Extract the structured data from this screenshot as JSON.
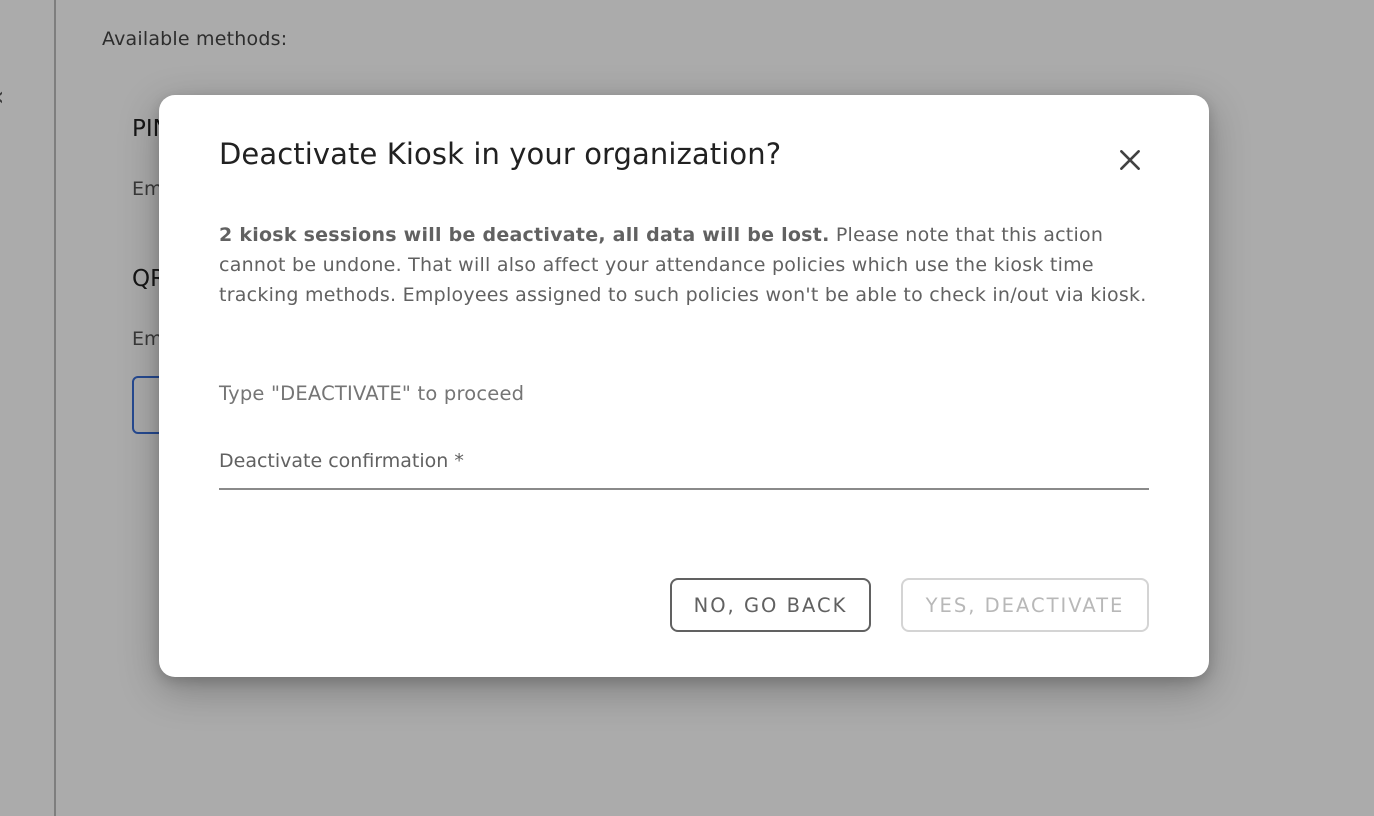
{
  "background": {
    "available_methods_label": "Available methods:",
    "methods": [
      {
        "title": "PIN",
        "subtitle": "Em"
      },
      {
        "title": "QR",
        "subtitle": "Em"
      }
    ]
  },
  "dialog": {
    "title": "Deactivate Kiosk in your organization?",
    "close_icon": "close-icon",
    "warning_bold": "2 kiosk sessions will be deactivate, all data will be lost.",
    "warning_text": " Please note that this action cannot be undone. That will also affect your attendance policies which use the kiosk time tracking methods. Employees assigned to such policies won't be able to check in/out via kiosk.",
    "instruction": "Type \"DEACTIVATE\" to proceed",
    "confirmation_field": {
      "label": "Deactivate confirmation *",
      "value": ""
    },
    "buttons": {
      "back_label": "NO, GO BACK",
      "deactivate_label": "YES, DEACTIVATE",
      "deactivate_disabled": true
    }
  },
  "colors": {
    "backdrop": "#000000",
    "dialog_bg": "#ffffff",
    "text_primary": "#212121",
    "text_secondary": "#616161",
    "disabled": "#d4d4d4",
    "bg_button_border": "#3a6fd8"
  }
}
